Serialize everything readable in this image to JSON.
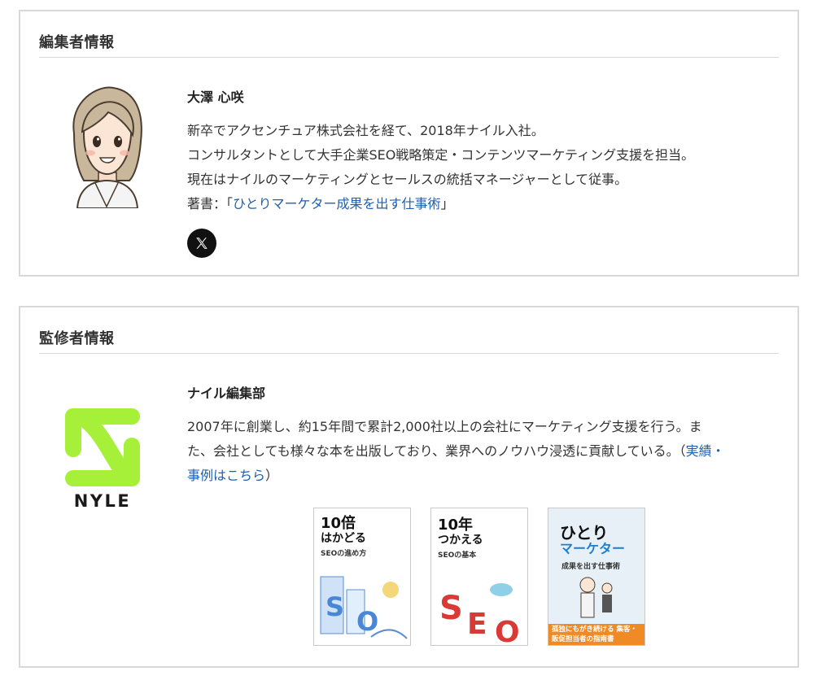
{
  "editor": {
    "section_title": "編集者情報",
    "name": "大澤 心咲",
    "bio_line1": "新卒でアクセンチュア株式会社を経て、2018年ナイル入社。",
    "bio_line2": "コンサルタントとして大手企業SEO戦略策定・コンテンツマーケティング支援を担当。",
    "bio_line3": "現在はナイルのマーケティングとセールスの統括マネージャーとして従事。",
    "book_prefix": "著書：",
    "book_open": "「",
    "book_link": "ひとりマーケター成果を出す仕事術",
    "book_close": "」",
    "social_icon": "x-logo-icon"
  },
  "supervisor": {
    "section_title": "監修者情報",
    "name": "ナイル編集部",
    "bio_line1": "2007年に創業し、約15年間で累計2,000社以上の会社にマーケティング支援を行う。ま",
    "bio_line2_text": "た、会社としても様々な本を出版しており、業界へのノウハウ浸透に貢献している。（",
    "bio_line2_link": "実績・",
    "bio_line3_link": "事例はこちら",
    "bio_line3_close": "）",
    "logo_text": "NYLE",
    "logo_color": "#a6f03a",
    "books": [
      {
        "title_a": "10倍",
        "title_b": "はかどる",
        "title_c": "SEOの進め方"
      },
      {
        "title_a": "10年",
        "title_b": "つかえる",
        "title_c": "SEOの基本"
      },
      {
        "title_a": "ひとり",
        "title_b": "マーケター",
        "title_c": "成果を出す仕事術",
        "band": "孤独にもがき続ける 集客・販促担当者の指南書"
      }
    ]
  }
}
